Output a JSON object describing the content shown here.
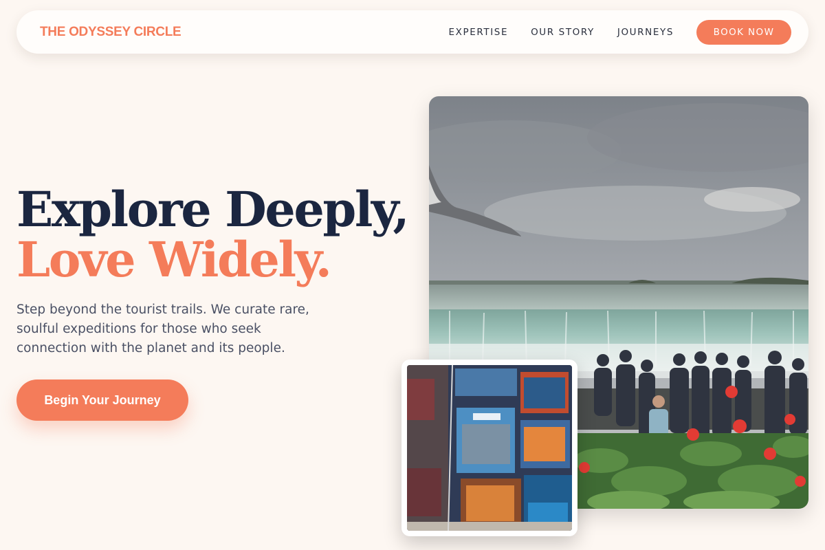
{
  "brand": {
    "name": "THE ODYSSEY CIRCLE"
  },
  "nav": {
    "links": [
      "EXPERTISE",
      "OUR STORY",
      "JOURNEYS"
    ],
    "cta_label": "BOOK NOW"
  },
  "hero": {
    "title_line1": "Explore Deeply,",
    "title_line2": "Love Widely.",
    "subtitle": "Step beyond the tourist trails. We curate rare, soulful expeditions for those who seek connection with the planet and its people.",
    "cta_label": "Begin Your Journey"
  },
  "images": {
    "main": "waterfall-viewpoint-photo",
    "inset": "postcard-rack-photo"
  },
  "colors": {
    "accent": "#f47c5a",
    "navy": "#1b2640",
    "background": "#fdf7f2"
  }
}
